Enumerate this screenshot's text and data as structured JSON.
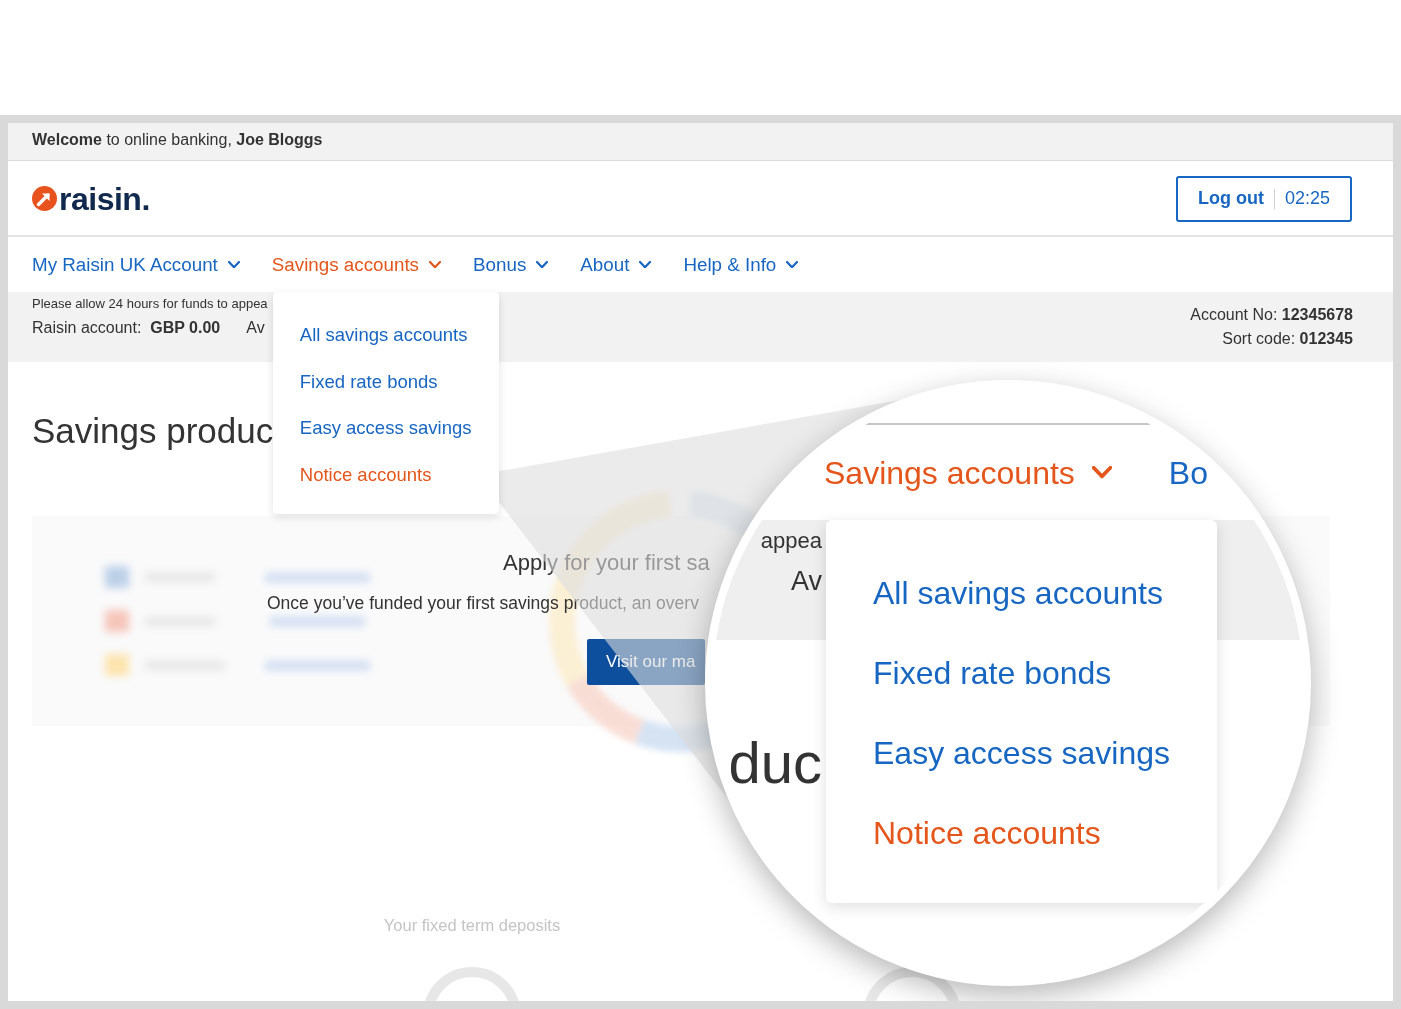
{
  "welcome_bar": {
    "text": "**Welcome** to online banking, **Joe Bloggs**"
  },
  "header": {
    "logo_text": "raisin.",
    "logout_button": {
      "label": "Log out",
      "timer": "02:25"
    }
  },
  "nav": {
    "items": [
      {
        "label": "My Raisin UK Account",
        "selected": false,
        "expanded": false
      },
      {
        "label": "Savings accounts",
        "selected": true,
        "expanded": true,
        "menu": [
          {
            "label": "All savings accounts",
            "selected": false
          },
          {
            "label": "Fixed rate bonds",
            "selected": false
          },
          {
            "label": "Easy access savings",
            "selected": false
          },
          {
            "label": "Notice accounts",
            "selected": true
          }
        ]
      },
      {
        "label": "Bonus",
        "selected": false,
        "expanded": false
      },
      {
        "label": "About",
        "selected": false,
        "expanded": false
      },
      {
        "label": "Help & Info",
        "selected": false,
        "expanded": false
      }
    ]
  },
  "info_bar": {
    "notice": "Please allow 24 hours for funds to appea",
    "balance": "Raisin account:  **GBP 0.00**",
    "available": "Av",
    "account_no": "Account No: **12345678**",
    "sort_code": "Sort code: **012345**"
  },
  "main": {
    "title": "Savings produc",
    "empty_state": {
      "heading": "Apply for your first sa",
      "text": "Once you’ve funded your first savings product, an overv",
      "button": "Visit our ma"
    },
    "section_title": "Your fixed term deposits"
  },
  "magnifier": {
    "nav_items": [
      {
        "label": "Savings accounts",
        "selected": true,
        "expanded": true,
        "menu": [
          {
            "label": "All savings accounts",
            "selected": false
          },
          {
            "label": "Fixed rate bonds",
            "selected": false
          },
          {
            "label": "Easy access savings",
            "selected": false
          },
          {
            "label": "Notice accounts",
            "selected": true
          }
        ]
      },
      {
        "label": "Bo",
        "selected": false,
        "expanded": false
      }
    ],
    "notice": "appea",
    "available": "Av",
    "title": "duc"
  }
}
